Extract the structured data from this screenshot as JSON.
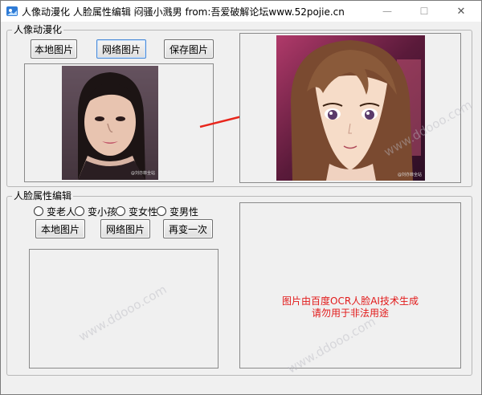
{
  "window": {
    "title": "人像动漫化 人脸属性编辑 闷骚小溅男 from:吾爱破解论坛www.52pojie.cn",
    "min_symbol": "—",
    "max_symbol": "☐",
    "close_symbol": "✕"
  },
  "anime_group": {
    "label": "人像动漫化",
    "buttons": {
      "local": "本地图片",
      "network": "网络图片",
      "save": "保存图片"
    },
    "source_watermark": "@刘亦菲全站",
    "result_watermark": "@刘亦菲全站"
  },
  "face_group": {
    "label": "人脸属性编辑",
    "radios": [
      "变老人",
      "变小孩",
      "变女性",
      "变男性"
    ],
    "buttons": {
      "local": "本地图片",
      "network": "网络图片",
      "again": "再变一次"
    },
    "notice_line1": "图片由百度OCR人脸AI技术生成",
    "notice_line2": "请勿用于非法用途"
  },
  "site_watermark": "www.ddooo.com",
  "colors": {
    "notice": "#e21a1a",
    "arrow": "#e8261c",
    "focus_border": "#4a8ad8"
  },
  "icons": {
    "app": "app-icon",
    "arrow": "right-arrow-icon"
  }
}
